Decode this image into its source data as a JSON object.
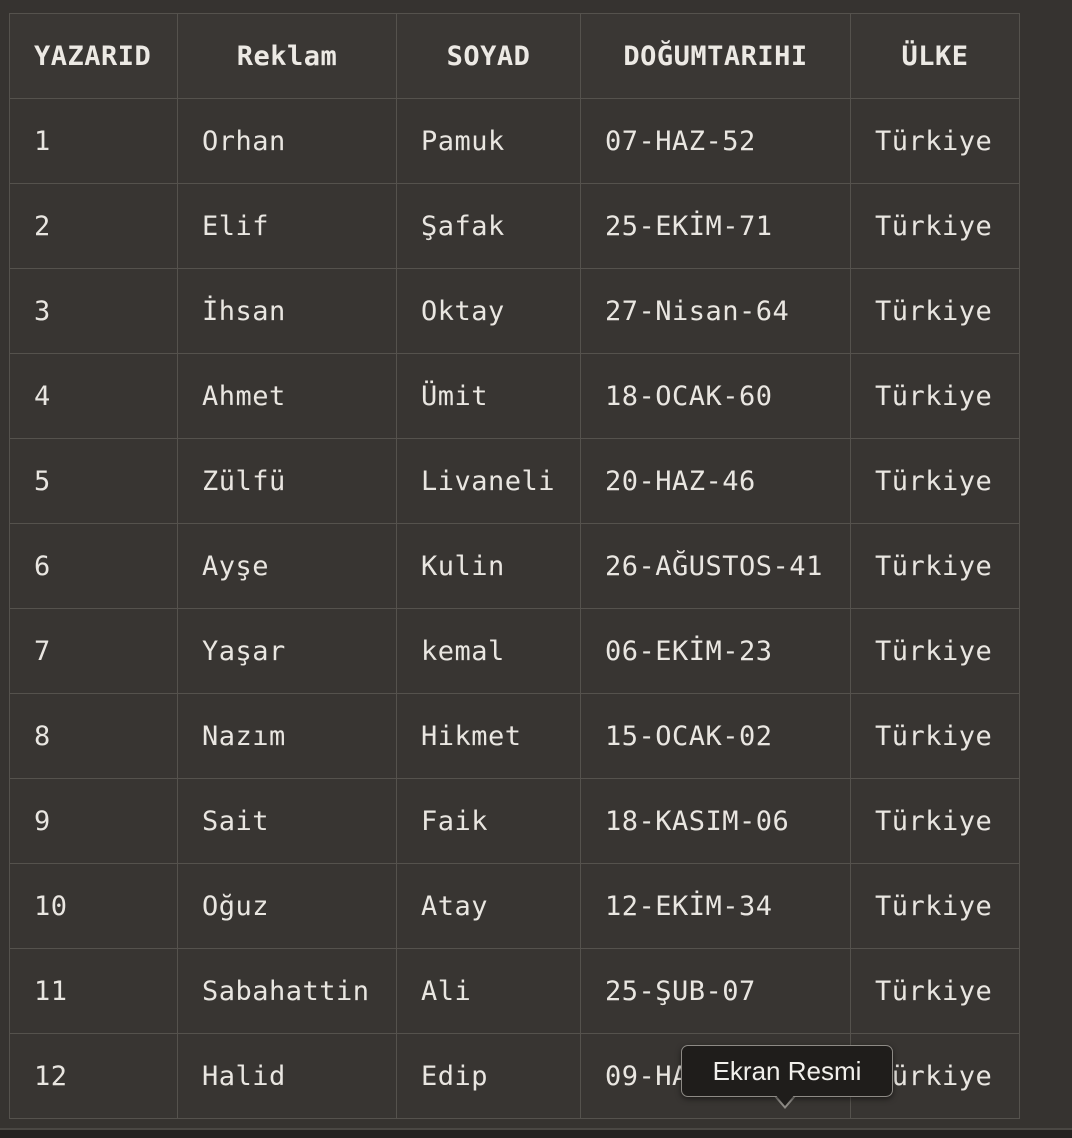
{
  "table": {
    "headers": [
      "YAZARID",
      "Reklam",
      "SOYAD",
      "DOĞUMTARIHI",
      "ÜLKE"
    ],
    "rows": [
      [
        "1",
        "Orhan",
        "Pamuk",
        "07-HAZ-52",
        "Türkiye"
      ],
      [
        "2",
        "Elif",
        "Şafak",
        "25-EKİM-71",
        "Türkiye"
      ],
      [
        "3",
        "İhsan",
        "Oktay",
        "27-Nisan-64",
        "Türkiye"
      ],
      [
        "4",
        "Ahmet",
        "Ümit",
        "18-OCAK-60",
        "Türkiye"
      ],
      [
        "5",
        "Zülfü",
        "Livaneli",
        "20-HAZ-46",
        "Türkiye"
      ],
      [
        "6",
        "Ayşe",
        "Kulin",
        "26-AĞUSTOS-41",
        "Türkiye"
      ],
      [
        "7",
        "Yaşar",
        "kemal",
        "06-EKİM-23",
        "Türkiye"
      ],
      [
        "8",
        "Nazım",
        "Hikmet",
        "15-OCAK-02",
        "Türkiye"
      ],
      [
        "9",
        "Sait",
        "Faik",
        "18-KASIM-06",
        "Türkiye"
      ],
      [
        "10",
        "Oğuz",
        "Atay",
        "12-EKİM-34",
        "Türkiye"
      ],
      [
        "11",
        "Sabahattin",
        "Ali",
        "25-ŞUB-07",
        "Türkiye"
      ],
      [
        "12",
        "Halid",
        "Edip",
        "09-HA",
        "Türkiye"
      ]
    ]
  },
  "tooltip": {
    "label": "Ekran Resmi"
  },
  "colors": {
    "background": "#363330",
    "grid_line": "#55524d",
    "text": "#e9e6e1",
    "tooltip_bg": "#1f1d1b"
  }
}
